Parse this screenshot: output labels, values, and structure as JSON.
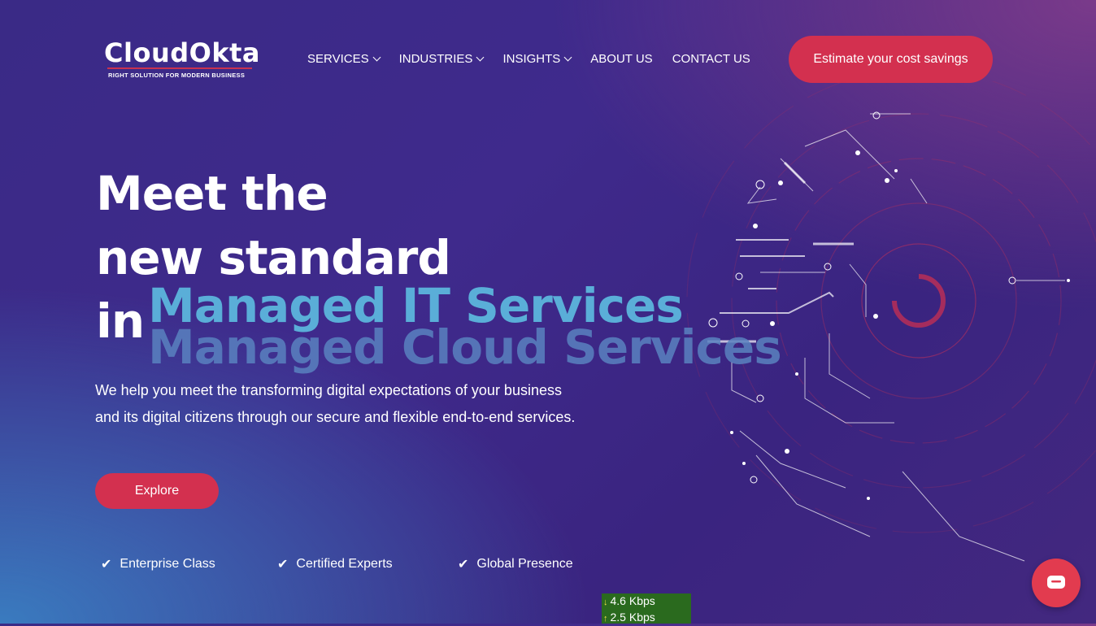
{
  "header": {
    "logo_title": "CloudOkta",
    "logo_tagline": "RIGHT SOLUTION FOR MODERN BUSINESS",
    "nav": [
      {
        "label": "SERVICES",
        "dropdown": true
      },
      {
        "label": "INDUSTRIES",
        "dropdown": true
      },
      {
        "label": "INSIGHTS",
        "dropdown": true
      },
      {
        "label": "ABOUT US",
        "dropdown": false
      },
      {
        "label": "CONTACT US",
        "dropdown": false
      }
    ],
    "cta_label": "Estimate your cost savings"
  },
  "hero": {
    "line1": "Meet the",
    "line2": "new standard",
    "line3_prefix": "in",
    "rotating_1": "Managed IT Services",
    "rotating_2": "Managed Cloud Services",
    "description": "We help you meet the transforming digital expectations of your business and its digital citizens through our secure and flexible end-to-end services.",
    "button_label": "Explore"
  },
  "features": [
    "Enterprise Class",
    "Certified Experts",
    "Global Presence"
  ],
  "network_meter": {
    "down": "4.6 Kbps",
    "up": "2.5 Kbps"
  },
  "colors": {
    "accent": "#d3304f",
    "background": "#3a2a86",
    "highlight": "#5aaed8"
  }
}
